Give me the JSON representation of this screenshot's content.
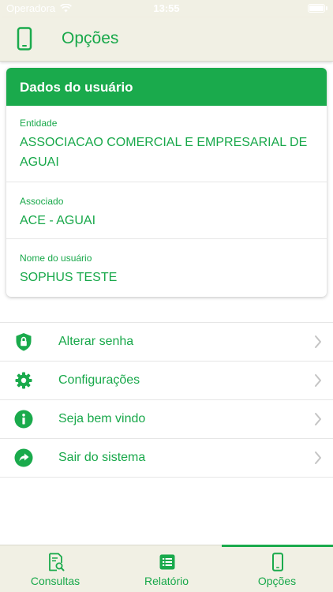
{
  "status_bar": {
    "carrier": "Operadora",
    "time": "13:55"
  },
  "header": {
    "title": "Opções",
    "icon": "smartphone-icon"
  },
  "user_card": {
    "title": "Dados do usuário",
    "entidade": {
      "label": "Entidade",
      "value": "ASSOCIACAO COMERCIAL E EMPRESARIAL DE AGUAI"
    },
    "associado": {
      "label": "Associado",
      "value": "ACE - AGUAI"
    },
    "nome": {
      "label": "Nome do usuário",
      "value": "SOPHUS TESTE"
    }
  },
  "menu": [
    {
      "label": "Alterar senha",
      "icon": "shield-lock-icon"
    },
    {
      "label": "Configurações",
      "icon": "gear-icon"
    },
    {
      "label": "Seja bem vindo",
      "icon": "info-icon"
    },
    {
      "label": "Sair do sistema",
      "icon": "share-arrow-icon"
    }
  ],
  "tabs": [
    {
      "label": "Consultas",
      "icon": "document-search-icon"
    },
    {
      "label": "Relatório",
      "icon": "list-icon"
    },
    {
      "label": "Opções",
      "icon": "smartphone-icon",
      "active": true
    }
  ],
  "colors": {
    "accent": "#1aaa4c",
    "bar_background": "#f1f0e4"
  }
}
